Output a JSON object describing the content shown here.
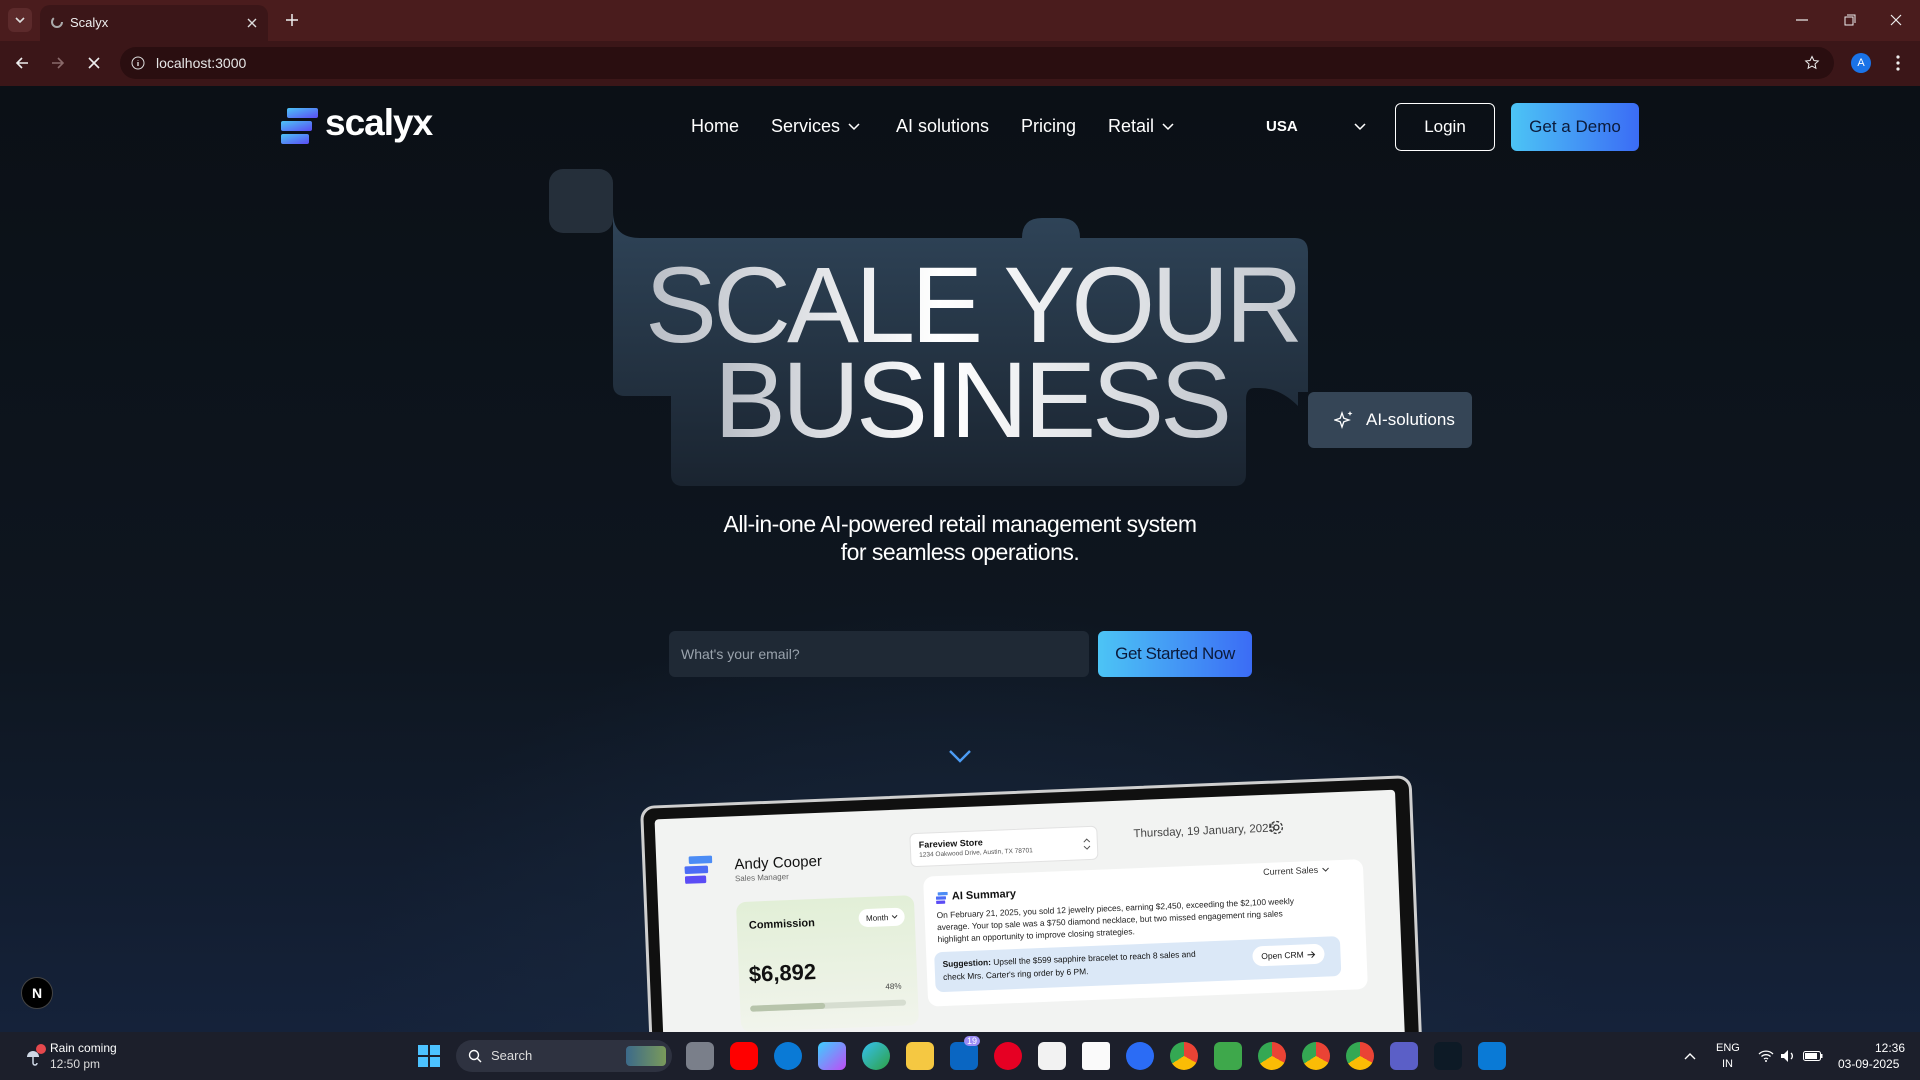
{
  "browser": {
    "tab_title": "Scalyx",
    "url": "localhost:3000",
    "profile_initial": "A"
  },
  "nav": {
    "logo_text": "scalyx",
    "links": [
      "Home",
      "Services",
      "AI solutions",
      "Pricing",
      "Retail"
    ],
    "region": "USA",
    "login": "Login",
    "demo": "Get a Demo"
  },
  "hero": {
    "line1": "SCALE YOUR",
    "line2": "BUSINESS",
    "pill": "AI-solutions",
    "subtitle_1": "All-in-one AI-powered retail management system",
    "subtitle_2": "for seamless operations.",
    "email_placeholder": "What's your email?",
    "cta": "Get Started Now"
  },
  "dashboard": {
    "user_name": "Andy Cooper",
    "user_role": "Sales Manager",
    "store_name": "Fareview Store",
    "store_address": "1234 Oakwood Drive, Austin, TX 78701",
    "date": "Thursday, 19 January, 2025",
    "commission_label": "Commission",
    "period": "Month",
    "commission_value": "$6,892",
    "commission_pct": "48%",
    "ai_title": "AI Summary",
    "sales_filter": "Current Sales",
    "summary_1": "On February 21, 2025, you sold 12 jewelry pieces, earning $2,450, exceeding the $2,100 weekly",
    "summary_2": "average. Your top sale was a $750 diamond necklace, but two missed engagement ring sales",
    "summary_3": "highlight an opportunity to improve closing strategies.",
    "suggestion_label": "Suggestion:",
    "suggestion_1": "Upsell the $599 sapphire bracelet to reach 8 sales and",
    "suggestion_2": "check Mrs. Carter's ring order by 6 PM.",
    "crm_button": "Open CRM",
    "progress": 0.48
  },
  "next_badge": "N",
  "taskbar": {
    "weather_title": "Rain coming",
    "weather_time": "12:50 pm",
    "search": "Search",
    "linkedin_badge": "19",
    "lang_1": "ENG",
    "lang_2": "IN",
    "time": "12:36",
    "date": "03-09-2025"
  },
  "colors": {
    "accent_from": "#4cc4f5",
    "accent_to": "#3b6cf5",
    "chrome": "#3b1618"
  }
}
